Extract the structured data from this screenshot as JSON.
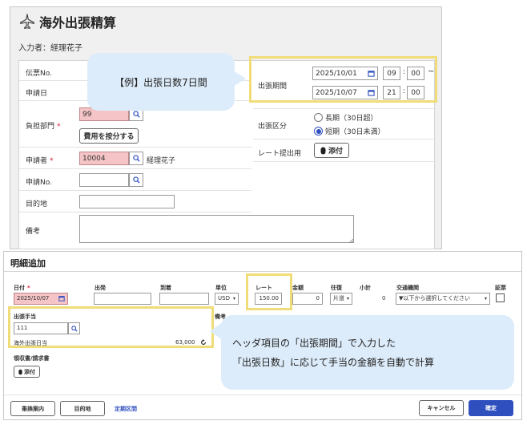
{
  "header": {
    "title": "海外出張精算",
    "inputter": "入力者：経理花子"
  },
  "form": {
    "voucher_label": "伝票No.",
    "apply_date_label": "申請日",
    "dept_label": "負担部門",
    "dept_value": "99",
    "split_button": "費用を按分する",
    "applicant_label": "申請者",
    "applicant_code": "10004",
    "applicant_name": "経理花子",
    "request_no_label": "申請No.",
    "destination_label": "目的地",
    "remarks_label": "備考",
    "required_mark": "*"
  },
  "trip": {
    "period_label": "出張期間",
    "start_date": "2025/10/01",
    "start_hour": "09",
    "start_min": "00",
    "end_date": "2025/10/07",
    "end_hour": "21",
    "end_min": "00",
    "colon": ":",
    "tilde": "~",
    "category_label": "出張区分",
    "long_option": "長期（30日超）",
    "short_option": "短期（30日未満）",
    "selected": "short",
    "rate_label": "レート提出用",
    "attach_button": "添付"
  },
  "callouts": {
    "example": "【例】出張日数7日間",
    "auto_calc_line1": "ヘッダ項目の「出張期間」で入力した",
    "auto_calc_line2": "「出張日数」に応じて手当の金額を自動で計算"
  },
  "detail": {
    "title": "明細追加",
    "cols": {
      "date": "日付",
      "from": "出発",
      "to": "到着",
      "unit": "単位",
      "rate": "レート",
      "amount": "金額",
      "round": "往復",
      "subtotal": "小計",
      "transport": "交通機関",
      "evidence": "証票"
    },
    "date_value": "2025/10/07",
    "unit_value": "USD",
    "rate_value": "150.00",
    "amount_value": "0",
    "round_value": "片道",
    "subtotal_value": "0",
    "transport_placeholder": "▼以下から選択してください",
    "allowance_label": "出張手当",
    "allowance_code": "111",
    "allowance_name": "海外出張日当",
    "allowance_amount": "63,000",
    "remarks_label": "備考",
    "receipt_label": "領収書/請求書",
    "attach_button": "添付",
    "transfer_button": "乗換案内",
    "destination_button": "目的地",
    "commuter_link": "定期区間",
    "cancel_button": "キャンセル",
    "confirm_button": "確定"
  },
  "colors": {
    "highlight": "#f0dc78",
    "callout_bg": "#ddecfa",
    "required_bg": "#f5c4c6",
    "primary_button": "#2f4fbf",
    "radio_selected": "#2f4fbf"
  }
}
